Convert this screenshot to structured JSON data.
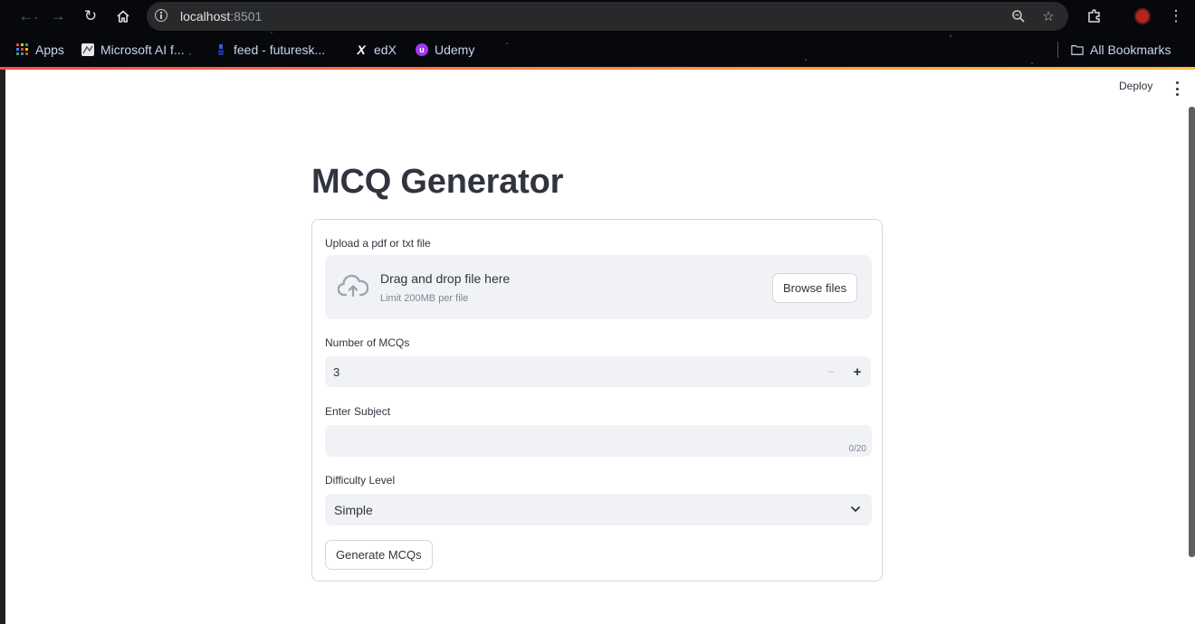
{
  "browser": {
    "url_host": "localhost",
    "url_port": ":8501",
    "bookmarks": [
      {
        "label": "Apps",
        "icon": "apps-grid-icon"
      },
      {
        "label": "Microsoft AI f...",
        "icon": "microsoft-ai-favicon"
      },
      {
        "label": "feed - futuresk...",
        "icon": "futureskills-favicon"
      },
      {
        "label": "edX",
        "icon": "edx-icon"
      },
      {
        "label": "Udemy",
        "icon": "udemy-icon"
      }
    ],
    "all_bookmarks": "All Bookmarks"
  },
  "header": {
    "deploy_label": "Deploy"
  },
  "main": {
    "title": "MCQ Generator",
    "upload": {
      "label": "Upload a pdf or txt file",
      "drop_text": "Drag and drop file here",
      "limit_text": "Limit 200MB per file",
      "browse_label": "Browse files"
    },
    "num_mcqs": {
      "label": "Number of MCQs",
      "value": "3"
    },
    "subject": {
      "label": "Enter Subject",
      "value": "",
      "counter": "0/20"
    },
    "difficulty": {
      "label": "Difficulty Level",
      "selected": "Simple"
    },
    "generate_label": "Generate MCQs"
  },
  "colors": {
    "accent_start": "#ff4b4b",
    "accent_end": "#ffbd45",
    "input_bg": "#f0f2f6",
    "text": "#31333f"
  }
}
